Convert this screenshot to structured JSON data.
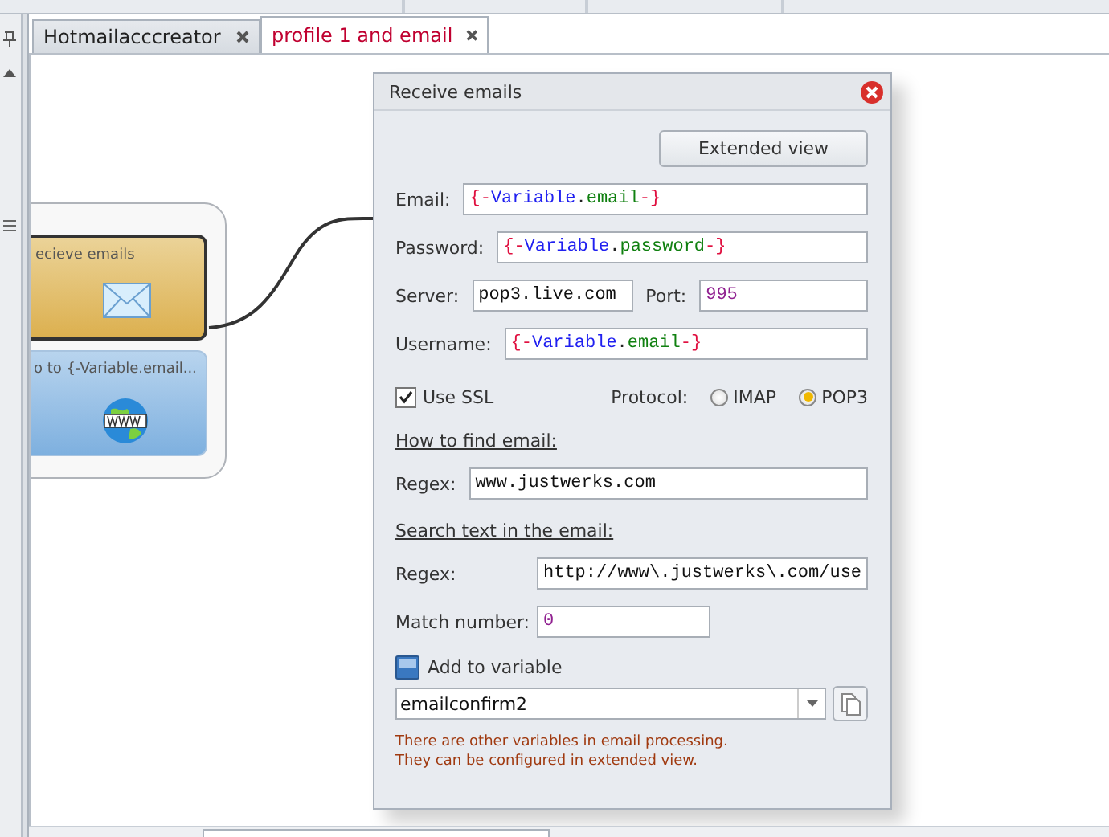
{
  "tabs": [
    {
      "label": "Hotmailacccreator",
      "selected": false
    },
    {
      "label": "profile 1 and email",
      "selected": true
    }
  ],
  "canvas": {
    "nodes": [
      {
        "kind": "email",
        "label": "ecieve emails",
        "selected": true
      },
      {
        "kind": "web",
        "label": "o to {-Variable.email...",
        "selected": false
      }
    ]
  },
  "dialog": {
    "title": "Receive emails",
    "extended_view": "Extended view",
    "email": {
      "label": "Email:",
      "value": "{-Variable.email-}",
      "kind": "variable"
    },
    "password": {
      "label": "Password:",
      "value": "{-Variable.password-}",
      "kind": "variable"
    },
    "server": {
      "label": "Server:",
      "value": "pop3.live.com"
    },
    "port": {
      "label": "Port:",
      "value": "995",
      "kind": "number"
    },
    "username": {
      "label": "Username:",
      "value": "{-Variable.email-}",
      "kind": "variable"
    },
    "use_ssl": {
      "label": "Use SSL",
      "checked": true
    },
    "protocol": {
      "label": "Protocol:",
      "options": [
        {
          "label": "IMAP",
          "selected": false
        },
        {
          "label": "POP3",
          "selected": true
        }
      ]
    },
    "find_section": {
      "heading": "How to find email:",
      "regex": {
        "label": "Regex:",
        "value": "www.justwerks.com"
      }
    },
    "search_section": {
      "heading": "Search text in the email:",
      "regex": {
        "label": "Regex:",
        "value": "http://www\\.justwerks\\.com/use"
      },
      "match_number": {
        "label": "Match number:",
        "value": "0",
        "kind": "number"
      }
    },
    "add_to_variable": {
      "label": "Add to variable",
      "value": "emailconfirm2"
    },
    "note": [
      "There are other variables in email processing.",
      "They can be configured in extended view."
    ]
  }
}
